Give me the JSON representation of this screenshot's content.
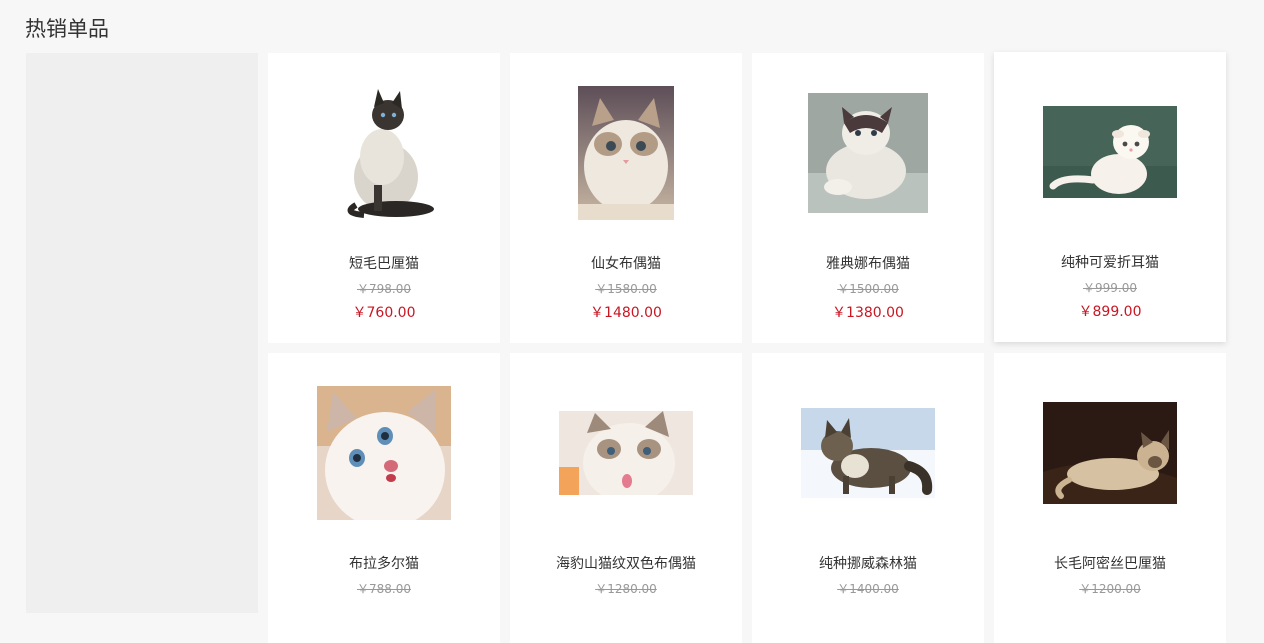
{
  "section": {
    "title": "热销单品"
  },
  "currency_symbol": "￥",
  "products": [
    {
      "name": "短毛巴厘猫",
      "old_price": "￥798.00",
      "price": "￥760.00",
      "image": "siamese-cat-sitting-photo"
    },
    {
      "name": "仙女布偶猫",
      "old_price": "￥1580.00",
      "price": "￥1480.00",
      "image": "ragdoll-kitten-photo"
    },
    {
      "name": "雅典娜布偶猫",
      "old_price": "￥1500.00",
      "price": "￥1380.00",
      "image": "ragdoll-cat-lying-photo"
    },
    {
      "name": "纯种可爱折耳猫",
      "old_price": "￥999.00",
      "price": "￥899.00",
      "image": "scottish-fold-kitten-photo"
    },
    {
      "name": "布拉多尔猫",
      "old_price": "￥788.00",
      "price": "",
      "image": "blue-eyed-white-kitten-photo"
    },
    {
      "name": "海豹山猫纹双色布偶猫",
      "old_price": "￥1280.00",
      "price": "",
      "image": "seal-lynx-ragdoll-kitten-photo"
    },
    {
      "name": "纯种挪威森林猫",
      "old_price": "￥1400.00",
      "price": "",
      "image": "norwegian-forest-cat-snow-photo"
    },
    {
      "name": "长毛阿密丝巴厘猫",
      "old_price": "￥1200.00",
      "price": "",
      "image": "balinese-cat-lying-photo"
    }
  ],
  "colors": {
    "page_bg": "#f7f7f7",
    "card_bg": "#ffffff",
    "price_red": "#c81623",
    "old_price_gray": "#999999",
    "banner_bg": "#efefef"
  }
}
